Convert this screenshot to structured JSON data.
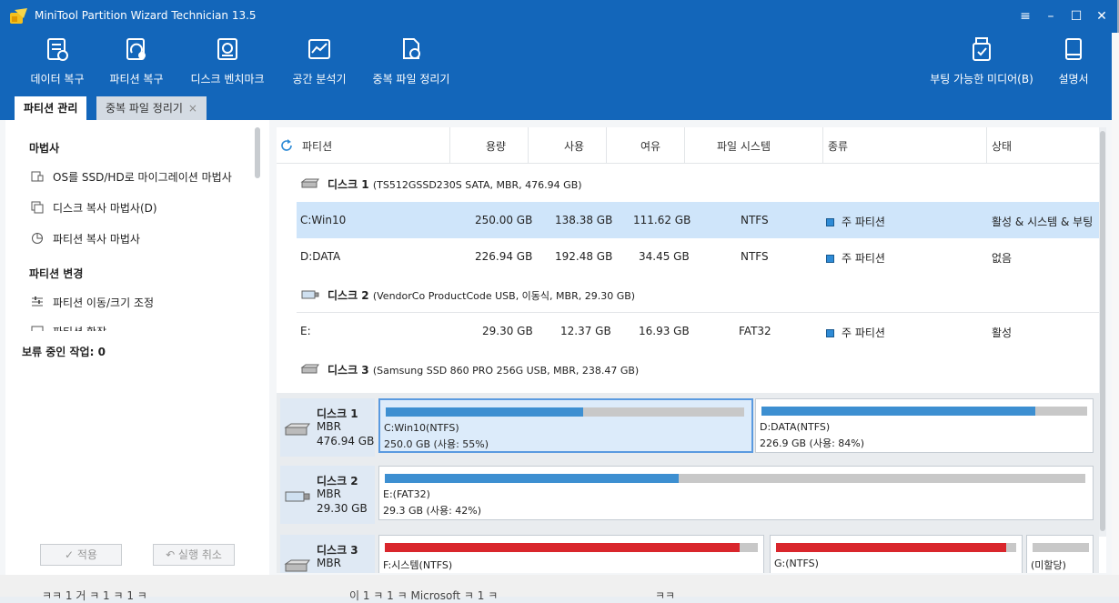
{
  "window": {
    "title": "MiniTool Partition Wizard Technician 13.5"
  },
  "toolbar": {
    "items": [
      {
        "label": "데이터 복구",
        "icon": "data-recovery-icon"
      },
      {
        "label": "파티션 복구",
        "icon": "partition-recovery-icon"
      },
      {
        "label": "디스크 벤치마크",
        "icon": "disk-benchmark-icon"
      },
      {
        "label": "공간 분석기",
        "icon": "space-analyzer-icon"
      },
      {
        "label": "중복 파일 정리기",
        "icon": "duplicate-file-cleaner-icon"
      }
    ],
    "right_items": [
      {
        "label": "부팅 가능한 미디어(B)",
        "icon": "bootable-media-icon"
      },
      {
        "label": "설명서",
        "icon": "manual-icon"
      }
    ]
  },
  "tabs": [
    {
      "label": "파티션 관리",
      "active": true
    },
    {
      "label": "중복 파일 정리기",
      "active": false,
      "close": "×"
    }
  ],
  "sidebar": {
    "section1": "마법사",
    "wizard_items": [
      "OS를 SSD/HD로 마이그레이션 마법사",
      "디스크 복사 마법사(D)",
      "파티션 복사 마법사"
    ],
    "section2": "파티션 변경",
    "change_items": [
      "파티션 이동/크기 조정",
      "파티션 확장"
    ],
    "pending": "보류 중인 작업: 0",
    "apply_label": "✓ 적용",
    "undo_label": "↶ 실행 취소"
  },
  "table": {
    "headers": [
      "파티션",
      "용량",
      "사용",
      "여유",
      "파일 시스템",
      "종류",
      "상태"
    ],
    "disks": [
      {
        "name": "디스크 1",
        "info": "(TS512GSSD230S SATA, MBR, 476.94 GB)",
        "partitions": [
          {
            "name": "C:Win10",
            "capacity": "250.00 GB",
            "used": "138.38 GB",
            "free": "111.62 GB",
            "fs": "NTFS",
            "type": "주 파티션",
            "status": "활성 & 시스템 & 부팅",
            "selected": true
          },
          {
            "name": "D:DATA",
            "capacity": "226.94 GB",
            "used": "192.48 GB",
            "free": "34.45 GB",
            "fs": "NTFS",
            "type": "주 파티션",
            "status": "없음",
            "selected": false
          }
        ]
      },
      {
        "name": "디스크 2",
        "info": "(VendorCo ProductCode USB, 이동식, MBR, 29.30 GB)",
        "partitions": [
          {
            "name": "E:",
            "capacity": "29.30 GB",
            "used": "12.37 GB",
            "free": "16.93 GB",
            "fs": "FAT32",
            "type": "주 파티션",
            "status": "활성",
            "selected": false
          }
        ]
      },
      {
        "name": "디스크 3",
        "info": "(Samsung SSD 860 PRO 256G USB, MBR, 238.47 GB)",
        "partitions": []
      }
    ]
  },
  "diskmap": [
    {
      "name": "디스크 1",
      "style": "MBR",
      "size": "476.94 GB",
      "parts": [
        {
          "label": "C:Win10(NTFS)",
          "info": "250.0 GB (사용: 55%)",
          "used_fraction": 0.55,
          "color": "#3d8fd1",
          "selected": true
        },
        {
          "label": "D:DATA(NTFS)",
          "info": "226.9 GB (사용: 84%)",
          "used_fraction": 0.84,
          "color": "#3d8fd1",
          "selected": false
        }
      ]
    },
    {
      "name": "디스크 2",
      "style": "MBR",
      "size": "29.30 GB",
      "parts": [
        {
          "label": "E:(FAT32)",
          "info": "29.3 GB (사용: 42%)",
          "used_fraction": 0.42,
          "color": "#3d8fd1",
          "selected": false
        }
      ]
    },
    {
      "name": "디스크 3",
      "style": "MBR",
      "size": "",
      "parts": [
        {
          "label": "F:시스템(NTFS)",
          "info": "",
          "used_fraction": 0.95,
          "color": "#d9262c",
          "selected": false
        },
        {
          "label": "G:(NTFS)",
          "info": "",
          "used_fraction": 0.96,
          "color": "#d9262c",
          "selected": false
        },
        {
          "label": "(미할당)",
          "info": "",
          "used_fraction": 0.0,
          "color": "#c8c8c8",
          "selected": false
        }
      ]
    }
  ],
  "background_text": [
    "ㅋㅋ 1 거 ㅋ 1 ㅋ 1 ㅋ",
    "이 1 ㅋ 1 ㅋ Microsoft ㅋ 1 ㅋ",
    "ㅋㅋ"
  ],
  "colors": {
    "titlebar": "#1366ba",
    "selected_row": "#cfe5fa",
    "used_blue": "#3d8fd1",
    "used_red": "#d9262c"
  }
}
